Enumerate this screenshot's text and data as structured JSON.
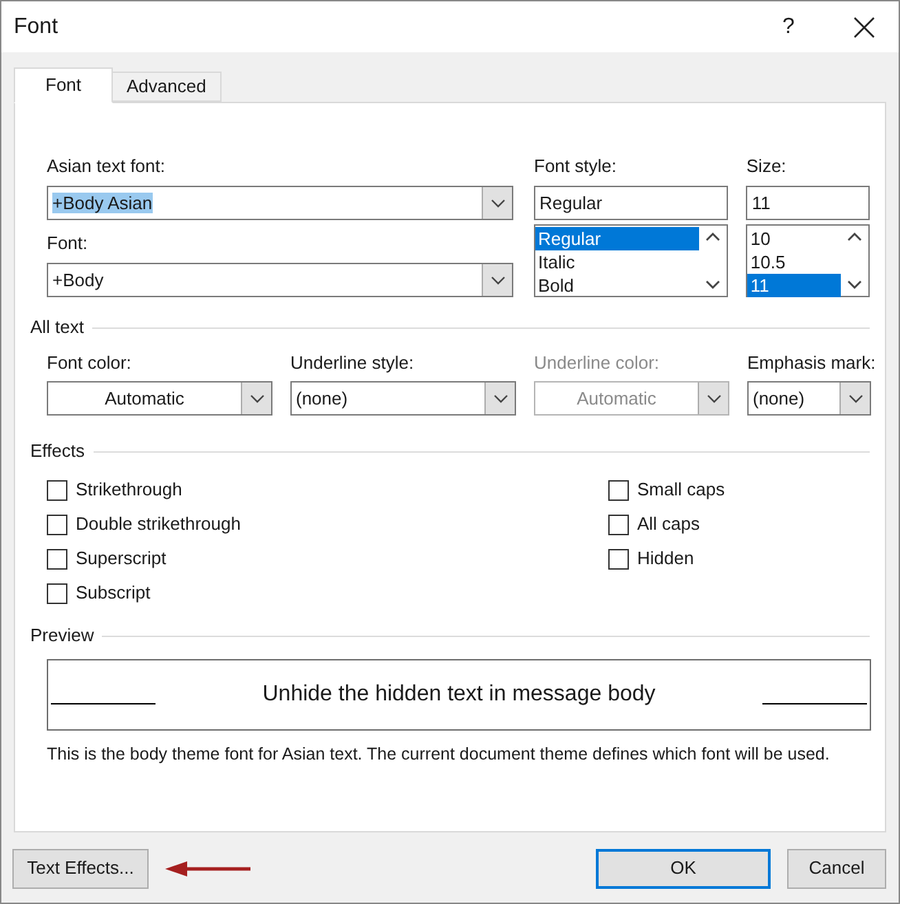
{
  "window": {
    "title": "Font",
    "help": "?"
  },
  "tabs": [
    {
      "label": "Font",
      "selected": true
    },
    {
      "label": "Advanced",
      "selected": false
    }
  ],
  "fonts": {
    "asian_font": {
      "label": "Asian text font:",
      "value": "+Body Asian",
      "text_selected": true
    },
    "font": {
      "label": "Font:",
      "value": "+Body",
      "text_selected": false
    },
    "font_style": {
      "label": "Font style:",
      "value": "Regular",
      "options": [
        {
          "label": "Regular",
          "selected": true
        },
        {
          "label": "Italic",
          "selected": false
        },
        {
          "label": "Bold",
          "selected": false
        }
      ]
    },
    "size": {
      "label": "Size:",
      "value": "11",
      "options": [
        {
          "label": "10",
          "selected": false
        },
        {
          "label": "10.5",
          "selected": false
        },
        {
          "label": "11",
          "selected": true
        }
      ]
    }
  },
  "all_text": {
    "title": "All text",
    "dropdowns": [
      {
        "label": "Font color:",
        "value": "Automatic",
        "kind": "color",
        "disabled": false
      },
      {
        "label": "Underline style:",
        "value": "(none)",
        "kind": "list",
        "disabled": false
      },
      {
        "label": "Underline color:",
        "value": "Automatic",
        "kind": "color",
        "disabled": true
      },
      {
        "label": "Emphasis mark:",
        "value": "(none)",
        "kind": "list",
        "disabled": false
      }
    ]
  },
  "effects": {
    "title": "Effects",
    "columns": [
      [
        {
          "label": "Strikethrough",
          "checked": false
        },
        {
          "label": "Double strikethrough",
          "checked": false
        },
        {
          "label": "Superscript",
          "checked": false
        },
        {
          "label": "Subscript",
          "checked": false
        }
      ],
      [
        {
          "label": "Small caps",
          "checked": false
        },
        {
          "label": "All caps",
          "checked": false
        },
        {
          "label": "Hidden",
          "checked": false
        }
      ]
    ]
  },
  "preview": {
    "title": "Preview",
    "sample": "Unhide the hidden text in message body",
    "note": "This is the body theme font for Asian text. The current document theme defines which font will be used."
  },
  "buttons": [
    {
      "label": "Text Effects...",
      "default": false
    },
    {
      "label": "OK",
      "default": true
    },
    {
      "label": "Cancel",
      "default": false
    }
  ]
}
